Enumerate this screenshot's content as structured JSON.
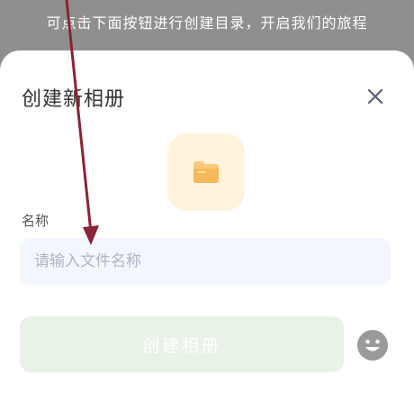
{
  "backdrop": {
    "hint_text": "可点击下面按钮进行创建目录，开启我们的旅程"
  },
  "dialog": {
    "title": "创建新相册",
    "close_icon": "close-icon",
    "folder_icon": "folder-icon",
    "name_label": "名称",
    "name_input": {
      "value": "",
      "placeholder": "请输入文件名称"
    },
    "create_button_label": "创建相册",
    "emoji_icon": "smiley-face-icon"
  },
  "colors": {
    "folder_tile_bg": "#fff3dc",
    "folder_icon": "#f9c978",
    "input_bg": "#f3f6fc",
    "create_button_bg": "#e8f2e6",
    "annotation_arrow": "#8b2235"
  }
}
